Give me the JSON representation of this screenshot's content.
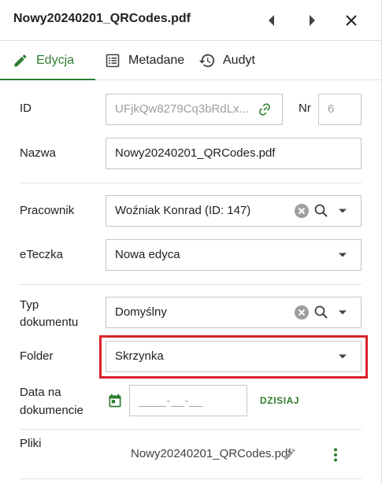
{
  "header": {
    "title": "Nowy20240201_QRCodes.pdf"
  },
  "tabs": [
    {
      "label": "Edycja",
      "active": true,
      "icon": "pencil-icon"
    },
    {
      "label": "Metadane",
      "active": false,
      "icon": "list-icon"
    },
    {
      "label": "Audyt",
      "active": false,
      "icon": "history-icon"
    }
  ],
  "form": {
    "id_label": "ID",
    "id_value": "UFjkQw8279Cq3bRdLx...",
    "nr_label": "Nr",
    "nr_value": "6",
    "name_label": "Nazwa",
    "name_value": "Nowy20240201_QRCodes.pdf",
    "employee_label": "Pracownik",
    "employee_value": "Woźniak Konrad (ID: 147)",
    "efolder_label": "eTeczka",
    "efolder_value": "Nowa edyca",
    "doctype_label_line1": "Typ",
    "doctype_label_line2": "dokumentu",
    "doctype_value": "Domyślny",
    "folder_label": "Folder",
    "folder_value": "Skrzynka",
    "date_label_line1": "Data na",
    "date_label_line2": "dokumencie",
    "date_placeholder": "____-__-__",
    "today_label": "DZISIAJ",
    "files_label": "Pliki",
    "file_name": "Nowy20240201_QRCodes.pdf"
  },
  "colors": {
    "accent": "#2e7d32",
    "highlight": "#d9222a",
    "border": "#c4c4c4"
  }
}
